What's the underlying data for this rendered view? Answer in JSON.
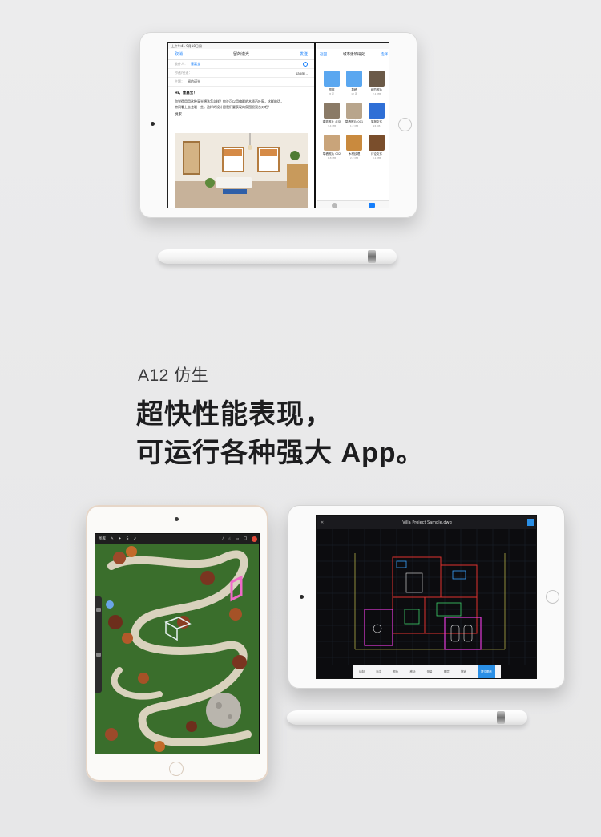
{
  "text": {
    "subtitle": "A12 仿生",
    "headline_line1": "超快性能表现，",
    "headline_line2": "可运行各种强大 App。"
  },
  "mail_app": {
    "status_time": "上午9:41 9月18日周一",
    "cancel": "取消",
    "title": "留的谨光",
    "send": "发送",
    "to_label": "收件人：",
    "to_value": "曹嘉宝",
    "cc_label": "抄送/密送：",
    "from_label": "发件人：",
    "from_value": "pao@...",
    "subject_label": "主题：",
    "subject_value": "留的谨光",
    "greeting": "Hi，曹嘉宝！",
    "body_line1": "你觉得用用这种采光想法怎么样？你许可以用偏暖的木质百叶窗，这样的话，",
    "body_line2": "房间看上去会暖一些。这样的设计跟我们要表现的氛围很契合对吧？",
    "sign": "悦家"
  },
  "files_app": {
    "back": "返回",
    "title": "城市建筑研究",
    "select": "选择",
    "items": [
      {
        "name": "图样",
        "sub": "8 项",
        "color": "#5aa7f0"
      },
      {
        "name": "草稿",
        "sub": "12 项",
        "color": "#5aa7f0"
      },
      {
        "name": "细节照片",
        "sub": "2.1 MB",
        "color": "#6b5a48"
      },
      {
        "name": "建筑照片 北京",
        "sub": "3.4 MB",
        "color": "#8a7a66"
      },
      {
        "name": "草稿照片 001",
        "sub": "1.2 MB",
        "color": "#b8a58c"
      },
      {
        "name": "简报文件",
        "sub": "24 KB",
        "color": "#2f6fd6"
      },
      {
        "name": "草稿照片 002",
        "sub": "1.8 MB",
        "color": "#c9a47a"
      },
      {
        "name": "木材纹理",
        "sub": "2.2 MB",
        "color": "#c98a3e"
      },
      {
        "name": "讨论文件",
        "sub": "3.1 MB",
        "color": "#7a4e2c"
      }
    ]
  },
  "procreate_app": {
    "gallery": "图库",
    "brush_color": "#e24a3a"
  },
  "cad_app": {
    "title": "Villa Project Sample.dwg",
    "tools": [
      "绘制",
      "标注",
      "颜色",
      "移动",
      "测量",
      "图层",
      "撤销",
      "提交图纸"
    ]
  },
  "colors": {
    "background": "#eaeaeb",
    "mail_blue": "#157efb",
    "cad_accent": "#2a8fe6",
    "gold_trim": "#e6d6c8"
  }
}
